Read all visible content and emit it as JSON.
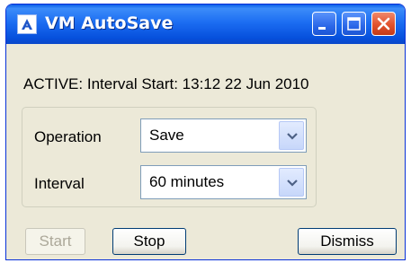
{
  "window": {
    "title": "VM AutoSave",
    "app_icon": "vm-autosave-icon",
    "controls": [
      "minimize-icon",
      "maximize-icon",
      "close-icon"
    ]
  },
  "status": {
    "text": "ACTIVE: Interval Start: 13:12 22 Jun 2010"
  },
  "settings": {
    "operation": {
      "label": "Operation",
      "value": "Save"
    },
    "interval": {
      "label": "Interval",
      "value": "60 minutes"
    }
  },
  "buttons": {
    "start": {
      "label": "Start",
      "enabled": false
    },
    "stop": {
      "label": "Stop",
      "enabled": true
    },
    "dismiss": {
      "label": "Dismiss",
      "enabled": true
    }
  },
  "colors": {
    "titlebar": "#1c6df2",
    "close_button": "#e2512c",
    "dialog_background": "#ece9d8",
    "disabled_text": "#aca899"
  }
}
